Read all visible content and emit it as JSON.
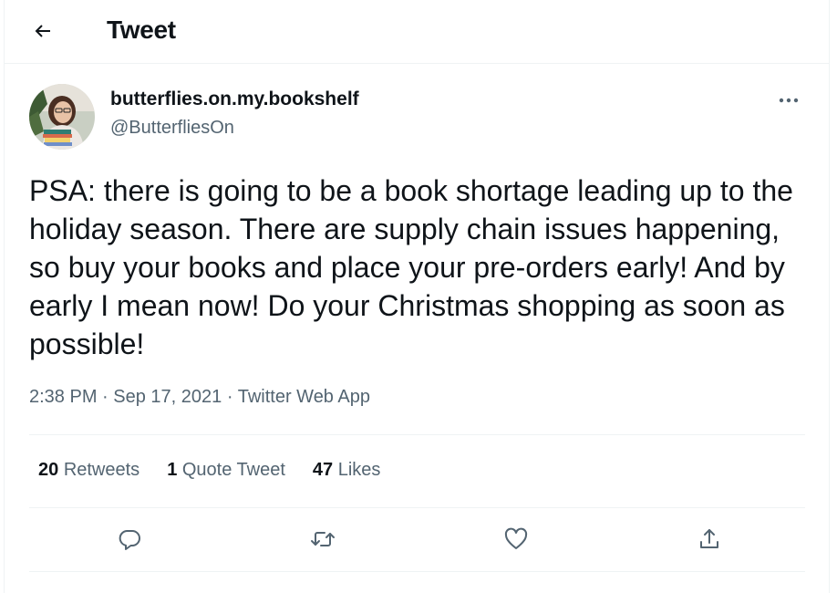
{
  "header": {
    "title": "Tweet",
    "back_icon": "arrow-left-icon"
  },
  "author": {
    "display_name": "butterflies.on.my.bookshelf",
    "handle": "@ButterfliesOn",
    "avatar_icon": "profile-avatar"
  },
  "tweet": {
    "text": "PSA: there is going to be a book shortage leading up to the holiday season. There are supply chain issues happening, so buy your books and place your pre-orders early! And by early I mean now! Do your Christmas shopping as soon as possible!",
    "time": "2:38 PM",
    "date": "Sep 17, 2021",
    "source": "Twitter Web App",
    "separator": "·"
  },
  "stats": [
    {
      "count": "20",
      "label": "Retweets"
    },
    {
      "count": "1",
      "label": "Quote Tweet"
    },
    {
      "count": "47",
      "label": "Likes"
    }
  ],
  "actions": [
    "reply-icon",
    "retweet-icon",
    "like-icon",
    "share-icon"
  ],
  "colors": {
    "text": "#0f1419",
    "secondary": "#536471",
    "border": "#eff3f4"
  }
}
